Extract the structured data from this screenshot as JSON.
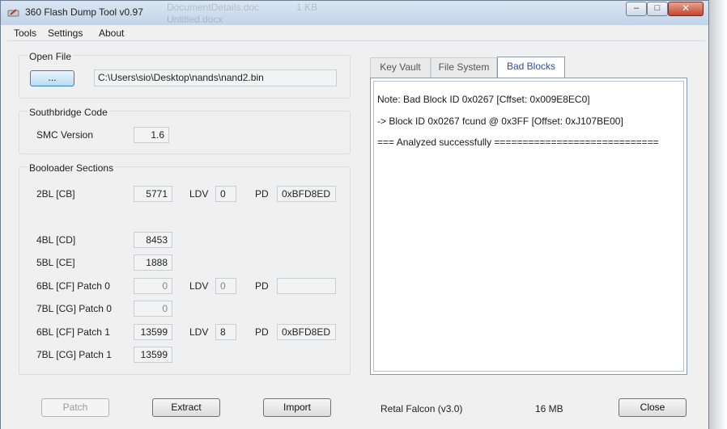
{
  "window": {
    "title": "360 Flash Dump Tool  v0.97",
    "background_text_1": "DocumentDetails.doc",
    "background_text_2": "Untitled.docx",
    "background_text_3": "1 KB"
  },
  "menu": [
    "Tools",
    "Settings",
    "About"
  ],
  "open_file": {
    "group_label": "Open File",
    "browse_label": "...",
    "path": "C:\\Users\\sio\\Desktop\\nands\\nand2.bin"
  },
  "southbridge": {
    "group_label": "Southbridge Code",
    "smc_label": "SMC Version",
    "smc_value": "1.6"
  },
  "bootloader": {
    "group_label": "Booloader Sections",
    "ldv_label": "LDV",
    "pd_label": "PD",
    "rows": {
      "cb": {
        "label": "2BL [CB]",
        "value": "5771",
        "ldv": "0",
        "pd": "0xBFD8ED"
      },
      "cd": {
        "label": "4BL [CD]",
        "value": "8453"
      },
      "ce": {
        "label": "5BL [CE]",
        "value": "1888"
      },
      "cf0": {
        "label": "6BL [CF] Patch 0",
        "value": "0",
        "ldv": "0",
        "pd": ""
      },
      "cg0": {
        "label": "7BL [CG] Patch 0",
        "value": "0"
      },
      "cf1": {
        "label": "6BL [CF] Patch 1",
        "value": "13599",
        "ldv": "8",
        "pd": "0xBFD8ED"
      },
      "cg1": {
        "label": "7BL [CG] Patch 1",
        "value": "13599"
      }
    }
  },
  "tabs": [
    "Key Vault",
    "File System",
    "Bad Blocks"
  ],
  "active_tab": "Bad Blocks",
  "log": [
    "Note: Bad Block ID 0x0267  [Cffset: 0x009E8EC0]",
    "->  Block ID 0x0267 fcund @ 0x3FF  [Offset: 0xJ107BE00]",
    "=== Analyzed successfully ============================="
  ],
  "footer": {
    "patch_label": "Patch",
    "extract_label": "Extract",
    "import_label": "Import",
    "console_info": "Retal Falcon (v3.0)",
    "size_info": "16 MB",
    "close_label": "Close"
  },
  "colors": {
    "accent": "#2a4fa0",
    "close_button": "#c4462d"
  }
}
